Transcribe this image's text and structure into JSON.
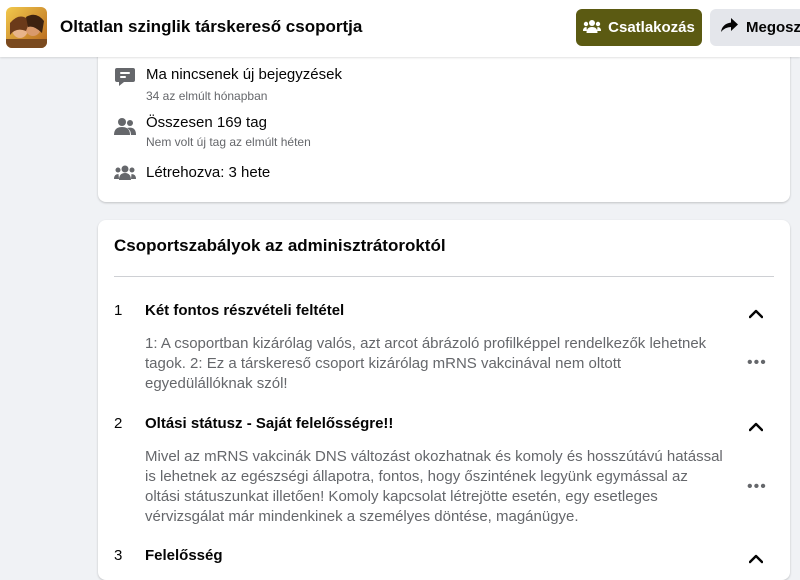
{
  "header": {
    "group_name": "Oltatlan szinglik társkereső csoportja",
    "join_label": "Csatlakozás",
    "share_label": "Megosz"
  },
  "about": {
    "posts": {
      "main": "Ma nincsenek új bejegyzések",
      "sub": "34 az elmúlt hónapban",
      "icon": "chat-bubble-icon"
    },
    "members": {
      "main": "Összesen 169 tag",
      "sub": "Nem volt új tag az elmúlt héten",
      "icon": "people-icon"
    },
    "created": {
      "main": "Létrehozva: 3 hete",
      "icon": "group-icon"
    }
  },
  "rules": {
    "title": "Csoportszabályok az adminisztrátoroktól",
    "items": [
      {
        "number": "1",
        "title": "Két fontos részvételi feltétel",
        "body": "1: A csoportban kizárólag valós, azt arcot ábrázoló profilképpel rendelkezők lehetnek tagok. 2: Ez a társkereső csoport kizárólag mRNS vakcinával nem oltott egyedülállóknak szól!"
      },
      {
        "number": "2",
        "title": "Oltási státusz - Saját felelősségre!!",
        "body": "Mivel az mRNS vakcinák DNS változást okozhatnak és komoly és hosszútávú hatással is lehetnek az egészségi állapotra, fontos, hogy őszintének legyünk egymással az oltási státuszunkat illetően! Komoly kapcsolat létrejötte esetén, egy esetleges vérvizsgálat már mindenkinek a személyes döntése, magánügye."
      },
      {
        "number": "3",
        "title": "Felelősség"
      }
    ]
  },
  "colors": {
    "join_button": "#5b5a12",
    "secondary_text": "#65676b",
    "background": "#f0f2f5"
  }
}
